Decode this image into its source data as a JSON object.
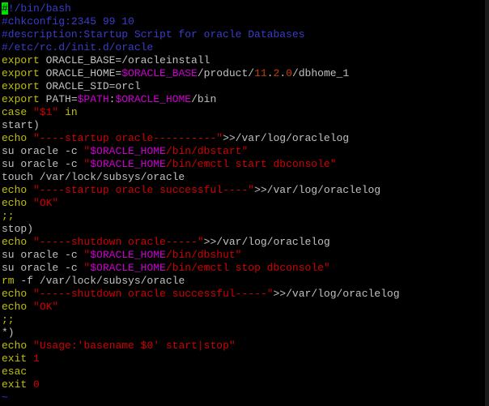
{
  "colors": {
    "background": "#000000",
    "text": "#c0c0c0",
    "keyword": "#c0c000",
    "comment": "#3c3ccc",
    "variable": "#cc00cc",
    "string": "#d00000",
    "number": "#c04000",
    "cursor": "#00e000",
    "tilde": "#3030ff"
  },
  "editor": {
    "lines": [
      [
        [
          "cursor",
          "#"
        ],
        [
          "comment",
          "!/bin/bash"
        ]
      ],
      [
        [
          "comment",
          "#chkconfig:2345 99 10"
        ]
      ],
      [
        [
          "comment",
          "#description:Startup Script for oracle Databases"
        ]
      ],
      [
        [
          "comment",
          "#/etc/rc.d/init.d/oracle"
        ]
      ],
      [
        [
          "keyword",
          "export"
        ],
        [
          "text",
          " ORACLE_BASE="
        ],
        [
          "text",
          "/oracleinstall"
        ]
      ],
      [
        [
          "keyword",
          "export"
        ],
        [
          "text",
          " ORACLE_HOME="
        ],
        [
          "variable",
          "$ORACLE_BASE"
        ],
        [
          "text",
          "/product/"
        ],
        [
          "number",
          "11"
        ],
        [
          "text",
          "."
        ],
        [
          "number",
          "2"
        ],
        [
          "text",
          "."
        ],
        [
          "number",
          "0"
        ],
        [
          "text",
          "/dbhome_1"
        ]
      ],
      [
        [
          "keyword",
          "export"
        ],
        [
          "text",
          " ORACLE_SID=orcl"
        ]
      ],
      [
        [
          "keyword",
          "export"
        ],
        [
          "text",
          " PATH="
        ],
        [
          "variable",
          "$PATH"
        ],
        [
          "text",
          ":"
        ],
        [
          "variable",
          "$ORACLE_HOME"
        ],
        [
          "text",
          "/bin"
        ]
      ],
      [
        [
          "keyword",
          "case"
        ],
        [
          "text",
          " "
        ],
        [
          "string",
          "\"$1\""
        ],
        [
          "text",
          " "
        ],
        [
          "keyword",
          "in"
        ]
      ],
      [
        [
          "text",
          "start)"
        ]
      ],
      [
        [
          "keyword",
          "echo"
        ],
        [
          "text",
          " "
        ],
        [
          "string",
          "\"----startup oracle----------\""
        ],
        [
          "text",
          ">>/var/log/oraclelog"
        ]
      ],
      [
        [
          "text",
          "su oracle -c "
        ],
        [
          "string",
          "\""
        ],
        [
          "variable",
          "$ORACLE_HOME"
        ],
        [
          "string",
          "/bin/dbstart\""
        ]
      ],
      [
        [
          "text",
          "su oracle -c "
        ],
        [
          "string",
          "\""
        ],
        [
          "variable",
          "$ORACLE_HOME"
        ],
        [
          "string",
          "/bin/emctl start dbconsole\""
        ]
      ],
      [
        [
          "text",
          "touch /var/lock/subsys/oracle"
        ]
      ],
      [
        [
          "keyword",
          "echo"
        ],
        [
          "text",
          " "
        ],
        [
          "string",
          "\"----startup oracle successful----\""
        ],
        [
          "text",
          ">>/var/log/oraclelog"
        ]
      ],
      [
        [
          "keyword",
          "echo"
        ],
        [
          "text",
          " "
        ],
        [
          "string",
          "\"OK\""
        ]
      ],
      [
        [
          "keyword",
          ";;"
        ]
      ],
      [
        [
          "text",
          "stop)"
        ]
      ],
      [
        [
          "keyword",
          "echo"
        ],
        [
          "text",
          " "
        ],
        [
          "string",
          "\"-----shutdown oracle-----\""
        ],
        [
          "text",
          ">>/var/log/oraclelog"
        ]
      ],
      [
        [
          "text",
          "su oracle -c "
        ],
        [
          "string",
          "\""
        ],
        [
          "variable",
          "$ORACLE_HOME"
        ],
        [
          "string",
          "/bin/dbshut\""
        ]
      ],
      [
        [
          "text",
          "su oracle -c "
        ],
        [
          "string",
          "\""
        ],
        [
          "variable",
          "$ORACLE_HOME"
        ],
        [
          "string",
          "/bin/emctl stop dbconsole\""
        ]
      ],
      [
        [
          "keyword",
          "rm"
        ],
        [
          "text",
          " -f /var/lock/subsys/oracle"
        ]
      ],
      [
        [
          "keyword",
          "echo"
        ],
        [
          "text",
          " "
        ],
        [
          "string",
          "\"-----shutdown oracle successful-----\""
        ],
        [
          "text",
          ">>/var/log/oraclelog"
        ]
      ],
      [
        [
          "keyword",
          "echo"
        ],
        [
          "text",
          " "
        ],
        [
          "string",
          "\"OK\""
        ]
      ],
      [
        [
          "keyword",
          ";;"
        ]
      ],
      [
        [
          "text",
          "*)"
        ]
      ],
      [
        [
          "keyword",
          "echo"
        ],
        [
          "text",
          " "
        ],
        [
          "string",
          "\"Usage:'basename $0' start|stop\""
        ]
      ],
      [
        [
          "keyword",
          "exit"
        ],
        [
          "text",
          " "
        ],
        [
          "string",
          "1"
        ]
      ],
      [
        [
          "keyword",
          "esac"
        ]
      ],
      [
        [
          "keyword",
          "exit"
        ],
        [
          "text",
          " "
        ],
        [
          "string",
          "0"
        ]
      ],
      [
        [
          "tilde",
          "~"
        ]
      ]
    ]
  }
}
